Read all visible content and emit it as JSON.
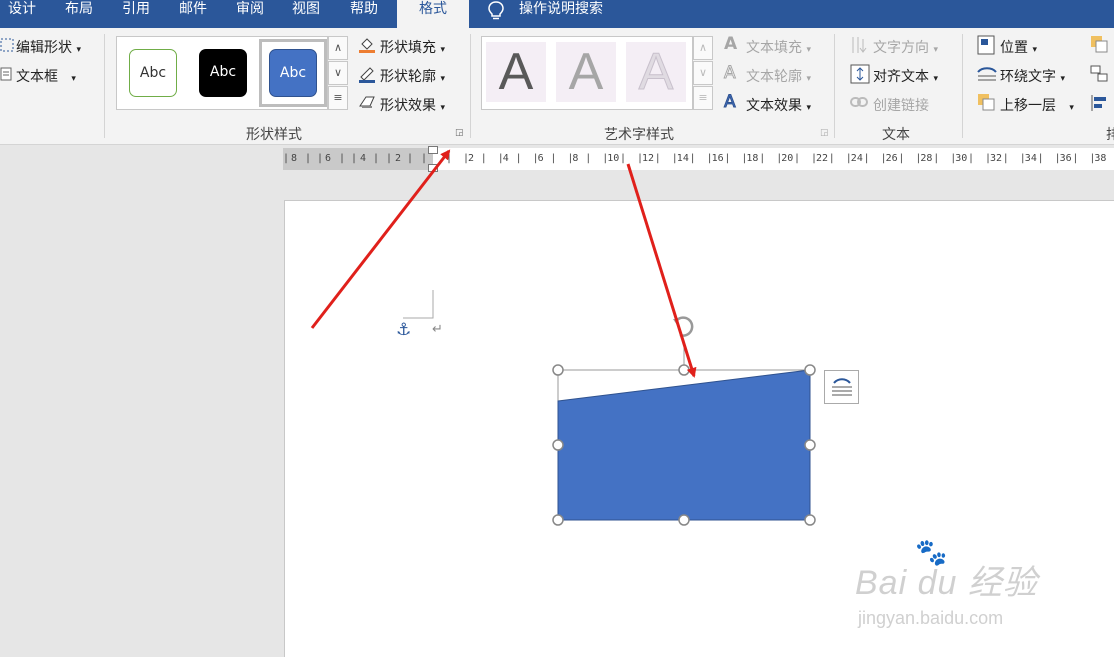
{
  "tabs": {
    "design": "设计",
    "layout": "布局",
    "references": "引用",
    "mailings": "邮件",
    "review": "审阅",
    "view": "视图",
    "help": "帮助",
    "format": "格式",
    "tell_me": "操作说明搜索"
  },
  "insert_shapes": {
    "edit_shape": "编辑形状",
    "text_box": "文本框"
  },
  "shape_styles": {
    "samples": [
      "Abc",
      "Abc",
      "Abc"
    ],
    "fill": "形状填充",
    "outline": "形状轮廓",
    "effects": "形状效果",
    "group_label": "形状样式"
  },
  "wordart_styles": {
    "letters": [
      "A",
      "A",
      "A"
    ],
    "text_fill": "文本填充",
    "text_outline": "文本轮廓",
    "text_effects": "文本效果",
    "group_label": "艺术字样式"
  },
  "text_group": {
    "text_direction": "文字方向",
    "align_text": "对齐文本",
    "create_link": "创建链接",
    "group_label": "文本"
  },
  "arrange_group": {
    "position": "位置",
    "wrap_text": "环绕文字",
    "bring_forward": "上移一层",
    "group_label": "排"
  },
  "ruler": {
    "left_labels": [
      "8",
      "6",
      "4",
      "2"
    ],
    "right_labels": [
      "2",
      "4",
      "6",
      "8",
      "10",
      "12",
      "14",
      "16",
      "18",
      "20",
      "22",
      "24",
      "26",
      "28",
      "30",
      "32",
      "34",
      "36",
      "38"
    ]
  },
  "document": {
    "paragraph_mark": "↵"
  },
  "watermark": {
    "brand": "Bai du 经验",
    "url": "jingyan.baidu.com"
  },
  "colors": {
    "title_bar": "#2b579a",
    "shape_fill": "#4472c4",
    "annotation_arrow": "#e0201b"
  }
}
